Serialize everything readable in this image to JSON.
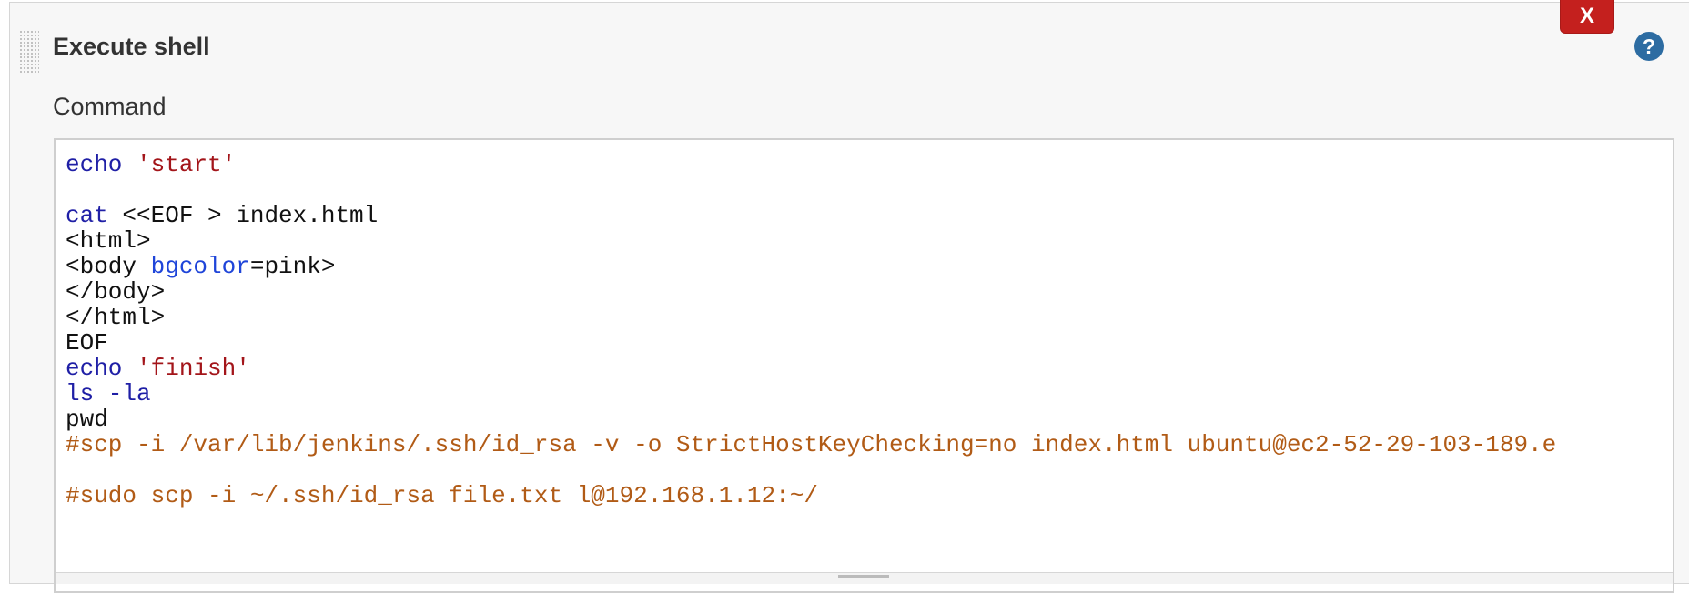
{
  "section": {
    "title": "Execute shell",
    "delete_label": "X",
    "help_icon": "question-circle-icon",
    "help_color": "#2d6ca2",
    "delete_color": "#c4201e"
  },
  "command": {
    "label": "Command",
    "lines": [
      {
        "segments": [
          {
            "text": "echo",
            "type": "kw"
          },
          {
            "text": " ",
            "type": "plain"
          },
          {
            "text": "'start'",
            "type": "str"
          }
        ]
      },
      {
        "segments": []
      },
      {
        "segments": [
          {
            "text": "cat",
            "type": "kw"
          },
          {
            "text": " <<EOF > index.html",
            "type": "plain"
          }
        ]
      },
      {
        "segments": [
          {
            "text": "<html>",
            "type": "plain"
          }
        ]
      },
      {
        "segments": [
          {
            "text": "<body ",
            "type": "plain"
          },
          {
            "text": "bgcolor",
            "type": "attr"
          },
          {
            "text": "=pink>",
            "type": "plain"
          }
        ]
      },
      {
        "segments": [
          {
            "text": "</body>",
            "type": "plain"
          }
        ]
      },
      {
        "segments": [
          {
            "text": "</html>",
            "type": "plain"
          }
        ]
      },
      {
        "segments": [
          {
            "text": "EOF",
            "type": "plain"
          }
        ]
      },
      {
        "segments": [
          {
            "text": "echo",
            "type": "kw"
          },
          {
            "text": " ",
            "type": "plain"
          },
          {
            "text": "'finish'",
            "type": "str"
          }
        ]
      },
      {
        "segments": [
          {
            "text": "ls -la",
            "type": "kw"
          }
        ]
      },
      {
        "segments": [
          {
            "text": "pwd",
            "type": "plain"
          }
        ]
      },
      {
        "segments": [
          {
            "text": "#scp -i /var/lib/jenkins/.ssh/id_rsa -v -o StrictHostKeyChecking=no index.html ubuntu@ec2-52-29-103-189.e",
            "type": "comment"
          }
        ]
      },
      {
        "segments": []
      },
      {
        "segments": [
          {
            "text": "#sudo scp -i ~/.ssh/id_rsa file.txt l@192.168.1.12:~/",
            "type": "comment"
          }
        ]
      }
    ]
  }
}
